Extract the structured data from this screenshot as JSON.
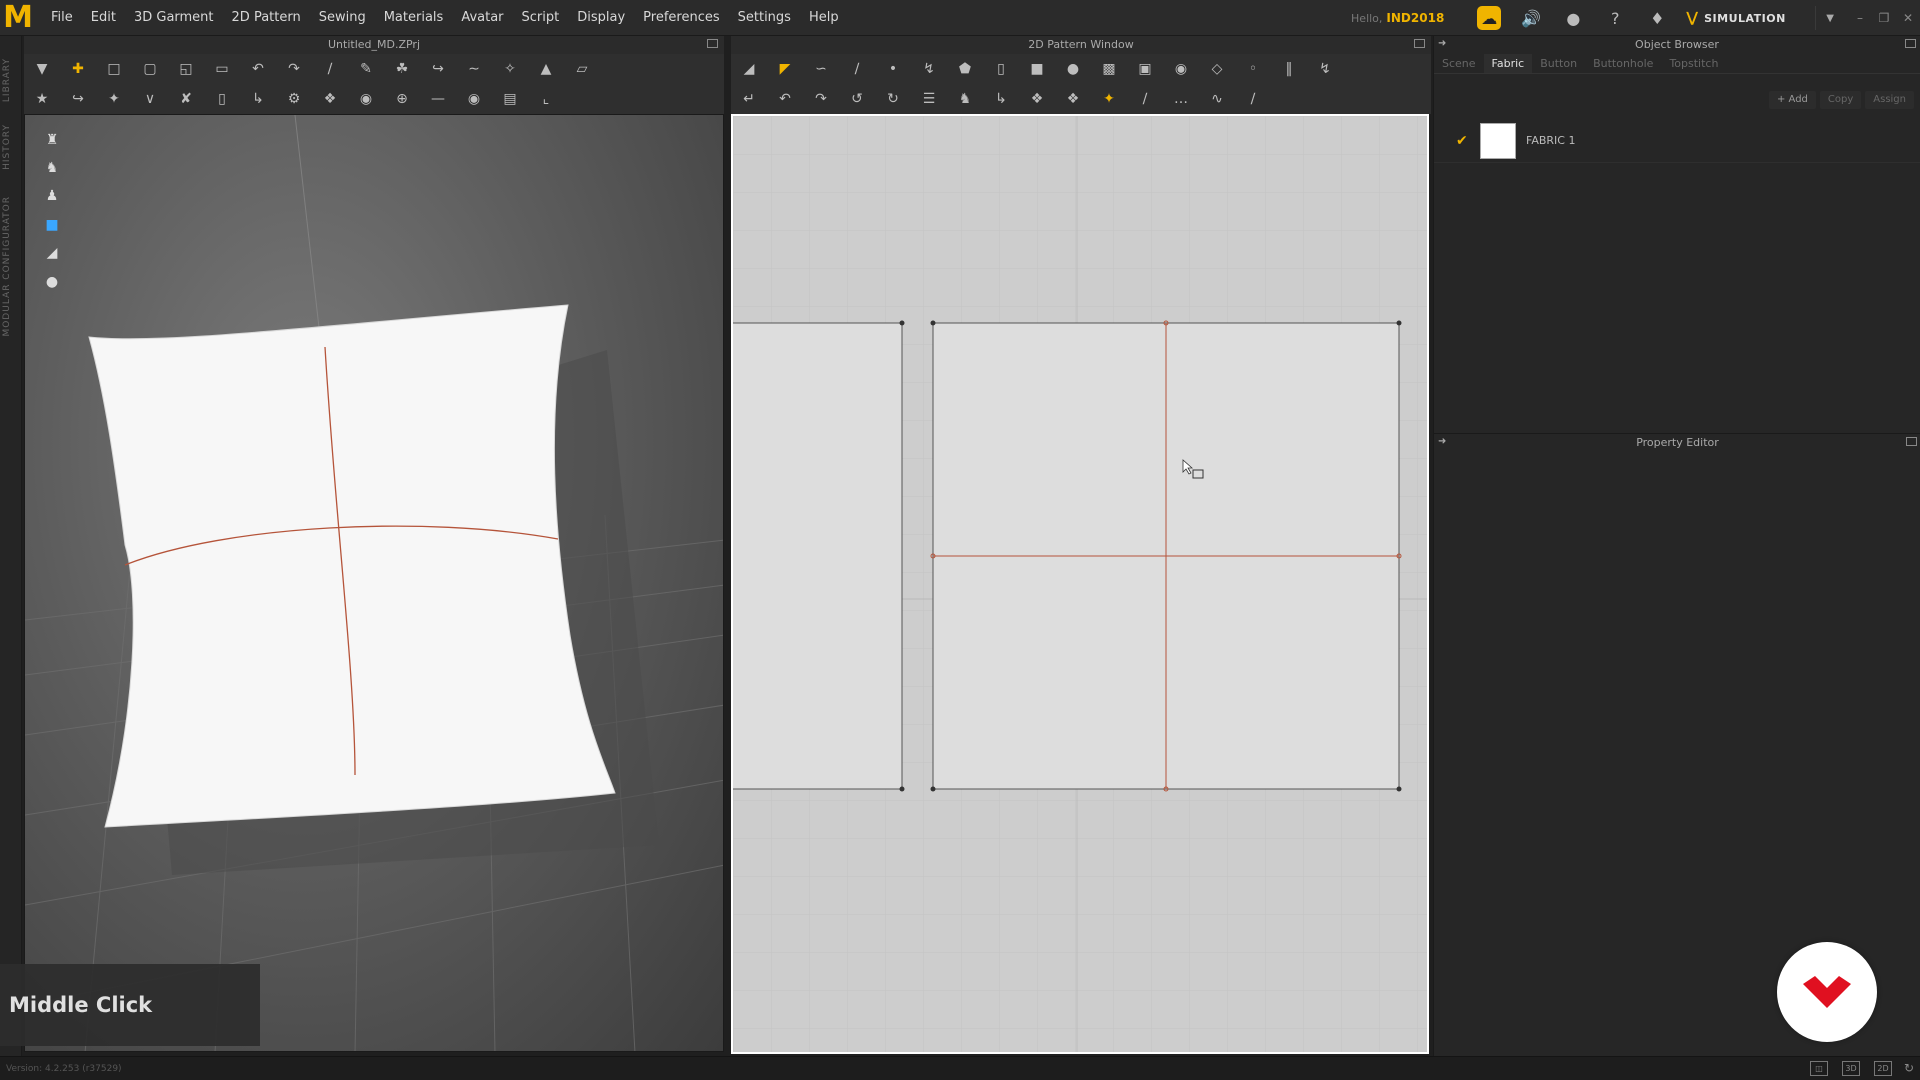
{
  "menubar": {
    "logo": "M",
    "items": [
      "File",
      "Edit",
      "3D Garment",
      "2D Pattern",
      "Sewing",
      "Materials",
      "Avatar",
      "Script",
      "Display",
      "Preferences",
      "Settings",
      "Help"
    ],
    "hello": "Hello,",
    "username": "IND2018",
    "mode": "SIMULATION"
  },
  "left_strip": {
    "tabs": [
      "LIBRARY",
      "HISTORY",
      "MODULAR CONFIGURATOR"
    ]
  },
  "view3d": {
    "title": "Untitled_MD.ZPrj",
    "toolbar_icons_row1": [
      "select-move",
      "transform",
      "box-select",
      "lasso",
      "fold",
      "sew-arrange",
      "pin",
      "pin-box",
      "draw-line",
      "brush",
      "steam",
      "iron",
      "fold-arrange",
      "reset-2d",
      "reset-3d",
      "drape",
      "solidify"
    ],
    "toolbar_icons_row2": [
      "avatar-measure",
      "tuck",
      "topstitch",
      "segment",
      "free-sew",
      "shrink",
      "strengthen",
      "copy-sew",
      "multi-sew",
      "puckering",
      "button",
      "buttonhole",
      "zipper",
      "tape",
      "strap"
    ],
    "viewport_tools": [
      "show-garment",
      "show-pattern",
      "show-avatar",
      "show-fabric-active",
      "show-texture",
      "show-avatar-body"
    ],
    "hint": "Middle Click"
  },
  "view2d": {
    "title": "2D Pattern Window",
    "toolbar_icons_row1": [
      "transform-pattern",
      "edit-pattern",
      "edit-curve",
      "curve-point",
      "add-point",
      "cut",
      "polygon",
      "rectangle",
      "ellipse",
      "fill",
      "fold-line",
      "trace",
      "internal-rect",
      "internal-circle",
      "dart",
      "notch",
      "grain",
      "baseline"
    ],
    "toolbar_icons_row2": [
      "segment-sew",
      "free-sew",
      "edit-sew",
      "check-sew",
      "tuck",
      "symmetric",
      "line-sew",
      "trim",
      "pin-2d",
      "pin-box-2d",
      "strengthen",
      "ruler",
      "measure",
      "tape-2d",
      "puckering-2d"
    ]
  },
  "object_browser": {
    "title": "Object Browser",
    "tabs": [
      "Scene",
      "Fabric",
      "Button",
      "Buttonhole",
      "Topstitch"
    ],
    "active_tab": "Fabric",
    "buttons": {
      "add": "+ Add",
      "copy": "Copy",
      "assign": "Assign"
    },
    "fabrics": [
      {
        "name": "FABRIC 1",
        "color": "#ffffff",
        "checked": true
      }
    ]
  },
  "property_editor": {
    "title": "Property Editor"
  },
  "statusbar": {
    "version": "Version: 4.2.253 (r37529)",
    "view_icons": [
      "layout-3d-2d",
      "3D",
      "2D",
      "refresh"
    ]
  },
  "colors": {
    "accent": "#f0b400",
    "seam": "#b5543a",
    "brand": "#e01020"
  }
}
